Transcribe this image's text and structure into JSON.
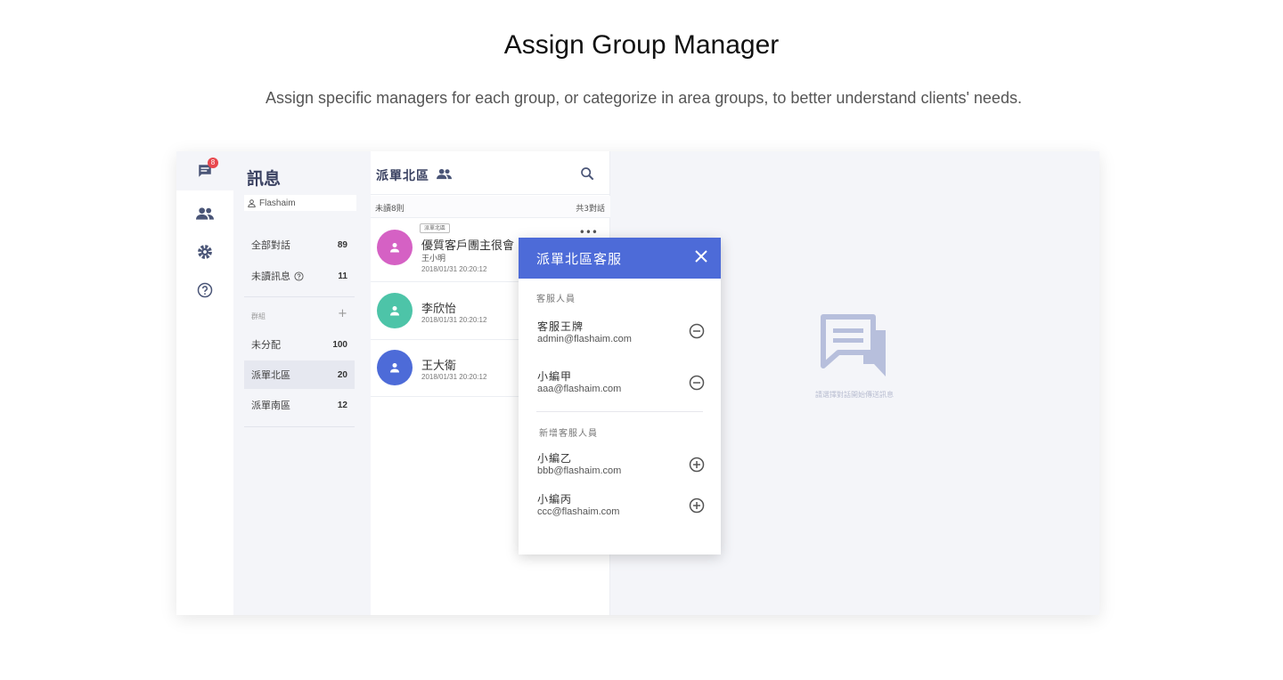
{
  "hero": {
    "title": "Assign Group Manager",
    "subtitle": "Assign specific managers for each group, or categorize in area groups,  to better understand clients' needs."
  },
  "rail": {
    "badge_count": "8",
    "icons": [
      "chat-icon",
      "contacts-icon",
      "settings-icon",
      "help-icon"
    ]
  },
  "sidebar": {
    "title": "訊息",
    "user": "Flashaim",
    "items": [
      {
        "label": "全部對話",
        "count": "89"
      },
      {
        "label": "未讀訊息",
        "count": "11"
      }
    ],
    "group_label": "群組",
    "groups": [
      {
        "label": "未分配",
        "count": "100"
      },
      {
        "label": "派單北區",
        "count": "20"
      },
      {
        "label": "派單南區",
        "count": "12"
      }
    ]
  },
  "list": {
    "title": "派單北區",
    "unread": "未讀8則",
    "total": "共3對話",
    "conversations": [
      {
        "tag": "派單北區",
        "name": "優質客戶團主很會",
        "sub": "王小明",
        "time": "2018/01/31 20:20:12",
        "color": "#d561c4"
      },
      {
        "name": "李欣怡",
        "time": "2018/01/31 20:20:12",
        "color": "#4dc4a8"
      },
      {
        "name": "王大衛",
        "time": "2018/01/31 20:20:12",
        "color": "#4d6bd8"
      }
    ]
  },
  "pane": {
    "empty_text": "請選擇對話開始傳送訊息"
  },
  "modal": {
    "title": "派單北區客服",
    "assigned_label": "客服人員",
    "assigned": [
      {
        "name": "客服王牌",
        "email": "admin@flashaim.com"
      },
      {
        "name": "小編甲",
        "email": "aaa@flashaim.com"
      }
    ],
    "add_label": "新增客服人員",
    "available": [
      {
        "name": "小編乙",
        "email": "bbb@flashaim.com"
      },
      {
        "name": "小編丙",
        "email": "ccc@flashaim.com"
      }
    ]
  },
  "colors": {
    "accent": "#4d6bd8",
    "badge": "#e8474d",
    "icon": "#4a5577"
  }
}
